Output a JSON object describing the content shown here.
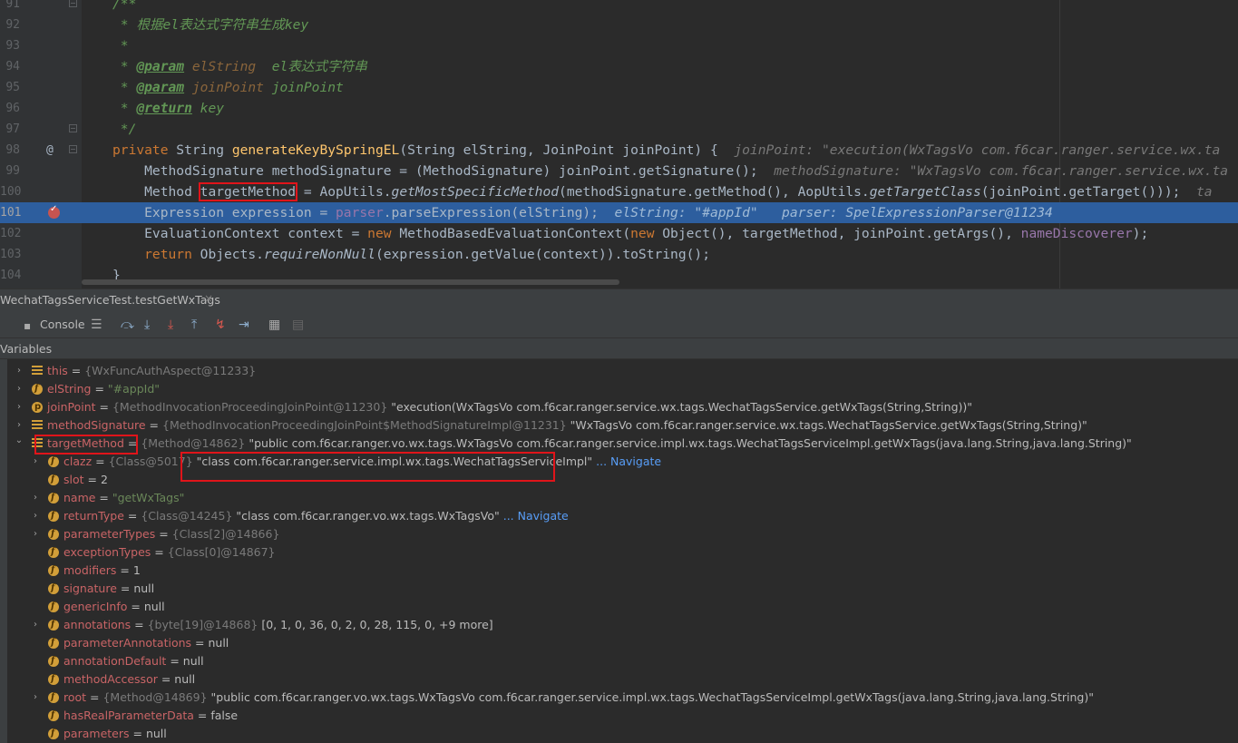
{
  "editor": {
    "lines": [
      {
        "n": "91"
      },
      {
        "n": "92"
      },
      {
        "n": "93"
      },
      {
        "n": "94"
      },
      {
        "n": "95"
      },
      {
        "n": "96"
      },
      {
        "n": "97"
      },
      {
        "n": "98"
      },
      {
        "n": "99"
      },
      {
        "n": "100"
      },
      {
        "n": "101"
      },
      {
        "n": "102"
      },
      {
        "n": "103"
      },
      {
        "n": "104"
      }
    ],
    "l91": "/**",
    "l92": " * 根据el表达式字符串生成key",
    "l93": " *",
    "l94_star": " * ",
    "l94_tag": "@param",
    "l94_arg": " elString",
    "l94_desc": "  el表达式字符串",
    "l95_star": " * ",
    "l95_tag": "@param",
    "l95_arg": " joinPoint",
    "l95_desc": " joinPoint",
    "l96_star": " * ",
    "l96_tag": "@return",
    "l96_desc": " key",
    "l97": " */",
    "l98_kw": "private",
    "l98_a": " String ",
    "l98_fn": "generateKeyBySpringEL",
    "l98_b": "(String elString, JoinPoint joinPoint) {",
    "l98_hint": "  joinPoint: \"execution(WxTagsVo com.f6car.ranger.service.wx.ta",
    "l99_a": "    MethodSignature methodSignature = (MethodSignature) joinPoint.getSignature();",
    "l99_hint": "  methodSignature: \"WxTagsVo com.f6car.ranger.service.wx.ta",
    "l100_a": "    Method ",
    "l100_var": "targetMethod",
    "l100_b": " = AopUtils.",
    "l100_s1": "getMostSpecificMethod",
    "l100_c": "(methodSignature.getMethod(), AopUtils.",
    "l100_s2": "getTargetClass",
    "l100_d": "(joinPoint.getTarget()));",
    "l100_hint": "  ta",
    "l101_a": "    Expression expression = ",
    "l101_field": "parser",
    "l101_b": ".parseExpression(elString);",
    "l101_hint": "  elString: \"#appId\"   parser: SpelExpressionParser@11234",
    "l102_a": "    EvaluationContext context = ",
    "l102_kw": "new",
    "l102_b": " MethodBasedEvaluationContext(",
    "l102_kw2": "new",
    "l102_c": " Object(), targetMethod, joinPoint.getArgs(), ",
    "l102_field": "nameDiscoverer",
    "l102_d": ");",
    "l103_kw": "    return",
    "l103_a": " Objects.",
    "l103_s": "requireNonNull",
    "l103_b": "(expression.getValue(context)).toString();",
    "l104": "}",
    "at_marker": "@"
  },
  "debug": {
    "tab_title": "WechatTagsServiceTest.testGetWxTags",
    "tab_close": "×",
    "console_label": "Console",
    "variables_title": "Variables"
  },
  "vars": [
    {
      "name": "this",
      "eq": " = ",
      "ref": "{WxFuncAuthAspect@11233}",
      "val": "",
      "nav": ""
    },
    {
      "name": "elString",
      "eq": " = ",
      "ref": "",
      "val": "\"#appId\"",
      "nav": ""
    },
    {
      "name": "joinPoint",
      "eq": " = ",
      "ref": "{MethodInvocationProceedingJoinPoint@11230}",
      "val": " \"execution(WxTagsVo com.f6car.ranger.service.wx.tags.WechatTagsService.getWxTags(String,String))\"",
      "nav": ""
    },
    {
      "name": "methodSignature",
      "eq": " = ",
      "ref": "{MethodInvocationProceedingJoinPoint$MethodSignatureImpl@11231}",
      "val": " \"WxTagsVo com.f6car.ranger.service.wx.tags.WechatTagsService.getWxTags(String,String)\"",
      "nav": ""
    },
    {
      "name": "targetMethod",
      "eq": " = ",
      "ref": "{Method@14862}",
      "val": " \"public com.f6car.ranger.vo.wx.tags.WxTagsVo com.f6car.ranger.service.impl.wx.tags.WechatTagsServiceImpl.getWxTags(java.lang.String,java.lang.String)\"",
      "nav": ""
    },
    {
      "name": "clazz",
      "eq": " = ",
      "ref": "{Class@5017}",
      "val": " \"class com.f6car.ranger.service.impl.wx.tags.WechatTagsServiceImpl\"",
      "nav": "... Navigate"
    },
    {
      "name": "slot",
      "eq": " = ",
      "ref": "",
      "val": "2",
      "nav": ""
    },
    {
      "name": "name",
      "eq": " = ",
      "ref": "",
      "val": "\"getWxTags\"",
      "nav": ""
    },
    {
      "name": "returnType",
      "eq": " = ",
      "ref": "{Class@14245}",
      "val": " \"class com.f6car.ranger.vo.wx.tags.WxTagsVo\"",
      "nav": "... Navigate"
    },
    {
      "name": "parameterTypes",
      "eq": " = ",
      "ref": "{Class[2]@14866}",
      "val": "",
      "nav": ""
    },
    {
      "name": "exceptionTypes",
      "eq": " = ",
      "ref": "{Class[0]@14867}",
      "val": "",
      "nav": ""
    },
    {
      "name": "modifiers",
      "eq": " = ",
      "ref": "",
      "val": "1",
      "nav": ""
    },
    {
      "name": "signature",
      "eq": " = ",
      "ref": "",
      "val": "null",
      "nav": ""
    },
    {
      "name": "genericInfo",
      "eq": " = ",
      "ref": "",
      "val": "null",
      "nav": ""
    },
    {
      "name": "annotations",
      "eq": " = ",
      "ref": "{byte[19]@14868}",
      "val": " [0, 1, 0, 36, 0, 2, 0, 28, 115, 0, +9 more]",
      "nav": ""
    },
    {
      "name": "parameterAnnotations",
      "eq": " = ",
      "ref": "",
      "val": "null",
      "nav": ""
    },
    {
      "name": "annotationDefault",
      "eq": " = ",
      "ref": "",
      "val": "null",
      "nav": ""
    },
    {
      "name": "methodAccessor",
      "eq": " = ",
      "ref": "",
      "val": "null",
      "nav": ""
    },
    {
      "name": "root",
      "eq": " = ",
      "ref": "{Method@14869}",
      "val": " \"public com.f6car.ranger.vo.wx.tags.WxTagsVo com.f6car.ranger.service.impl.wx.tags.WechatTagsServiceImpl.getWxTags(java.lang.String,java.lang.String)\"",
      "nav": ""
    },
    {
      "name": "hasRealParameterData",
      "eq": " = ",
      "ref": "",
      "val": "false",
      "nav": ""
    },
    {
      "name": "parameters",
      "eq": " = ",
      "ref": "",
      "val": "null",
      "nav": ""
    }
  ]
}
